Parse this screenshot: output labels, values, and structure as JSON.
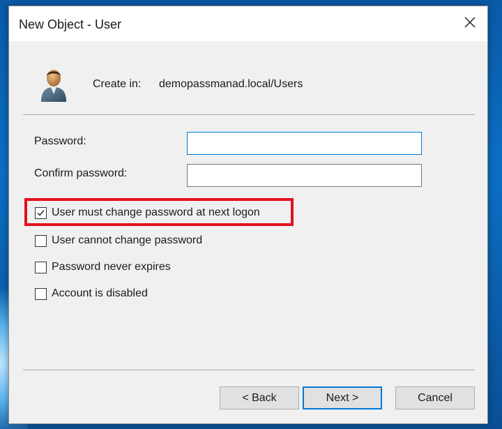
{
  "window": {
    "title": "New Object - User"
  },
  "header": {
    "create_in_label": "Create in:",
    "create_in_path": "demopassmanad.local/Users"
  },
  "fields": {
    "password": {
      "label": "Password:",
      "value": ""
    },
    "confirm_password": {
      "label": "Confirm password:",
      "value": ""
    }
  },
  "options": [
    {
      "label": "User must change password at next logon",
      "checked": true
    },
    {
      "label": "User cannot change password",
      "checked": false
    },
    {
      "label": "Password never expires",
      "checked": false
    },
    {
      "label": "Account is disabled",
      "checked": false
    }
  ],
  "buttons": {
    "back": "< Back",
    "next": "Next >",
    "cancel": "Cancel"
  },
  "colors": {
    "highlight": "#e3101d",
    "focus": "#0078d7",
    "dialog_bg": "#f0f0f0"
  },
  "icons": {
    "close": "close-icon",
    "user": "user-icon",
    "check": "checkmark-icon"
  }
}
